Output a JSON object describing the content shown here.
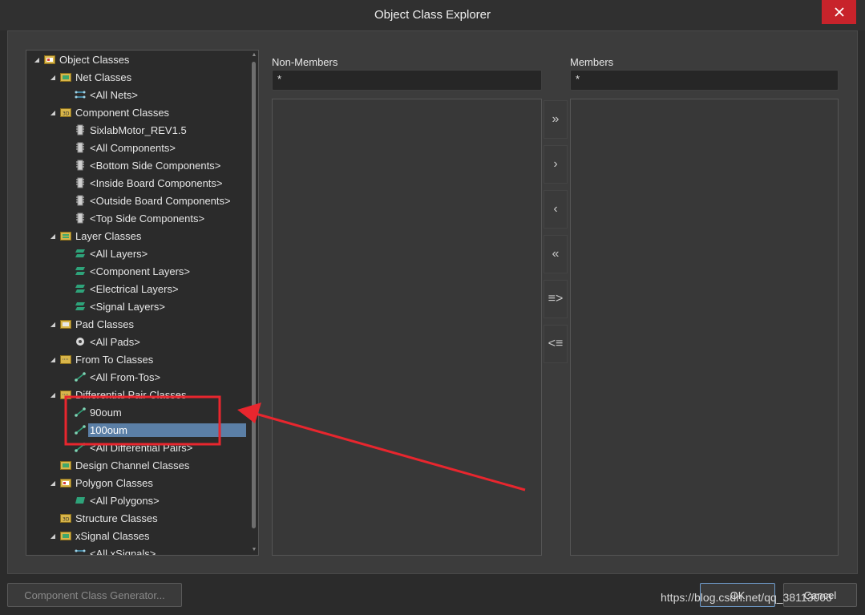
{
  "window": {
    "title": "Object Class Explorer"
  },
  "tree": [
    {
      "label": "Object Classes",
      "level": 0,
      "expanded": true,
      "icon": "object-classes-icon"
    },
    {
      "label": "Net Classes",
      "level": 1,
      "expanded": true,
      "icon": "net-classes-icon"
    },
    {
      "label": "<All Nets>",
      "level": 2,
      "icon": "net-icon"
    },
    {
      "label": "Component Classes",
      "level": 1,
      "expanded": true,
      "icon": "component-classes-icon"
    },
    {
      "label": "SixlabMotor_REV1.5",
      "level": 2,
      "icon": "component-icon"
    },
    {
      "label": "<All Components>",
      "level": 2,
      "icon": "component-icon"
    },
    {
      "label": "<Bottom Side Components>",
      "level": 2,
      "icon": "component-icon"
    },
    {
      "label": "<Inside Board Components>",
      "level": 2,
      "icon": "component-icon"
    },
    {
      "label": "<Outside Board Components>",
      "level": 2,
      "icon": "component-icon"
    },
    {
      "label": "<Top Side Components>",
      "level": 2,
      "icon": "component-icon"
    },
    {
      "label": "Layer Classes",
      "level": 1,
      "expanded": true,
      "icon": "layer-classes-icon"
    },
    {
      "label": "<All Layers>",
      "level": 2,
      "icon": "layer-icon"
    },
    {
      "label": "<Component Layers>",
      "level": 2,
      "icon": "layer-icon"
    },
    {
      "label": "<Electrical Layers>",
      "level": 2,
      "icon": "layer-icon"
    },
    {
      "label": "<Signal Layers>",
      "level": 2,
      "icon": "layer-icon"
    },
    {
      "label": "Pad Classes",
      "level": 1,
      "expanded": true,
      "icon": "pad-classes-icon"
    },
    {
      "label": "<All Pads>",
      "level": 2,
      "icon": "pad-icon"
    },
    {
      "label": "From To Classes",
      "level": 1,
      "expanded": true,
      "icon": "fromto-classes-icon"
    },
    {
      "label": "<All From-Tos>",
      "level": 2,
      "icon": "fromto-icon"
    },
    {
      "label": "Differential Pair Classes",
      "level": 1,
      "expanded": true,
      "icon": "diffpair-classes-icon"
    },
    {
      "label": "90oum",
      "level": 2,
      "icon": "diffpair-icon"
    },
    {
      "label": "100oum",
      "level": 2,
      "icon": "diffpair-icon",
      "selected": true
    },
    {
      "label": "<All Differential Pairs>",
      "level": 2,
      "icon": "diffpair-icon"
    },
    {
      "label": "Design Channel Classes",
      "level": 1,
      "icon": "design-channel-classes-icon"
    },
    {
      "label": "Polygon Classes",
      "level": 1,
      "expanded": true,
      "icon": "polygon-classes-icon"
    },
    {
      "label": "<All Polygons>",
      "level": 2,
      "icon": "polygon-icon"
    },
    {
      "label": "Structure Classes",
      "level": 1,
      "icon": "structure-classes-icon"
    },
    {
      "label": "xSignal Classes",
      "level": 1,
      "expanded": true,
      "icon": "xsignal-classes-icon"
    },
    {
      "label": "<All xSignals>",
      "level": 2,
      "icon": "xsignal-icon"
    }
  ],
  "non_members": {
    "label": "Non-Members",
    "filter": "*"
  },
  "members": {
    "label": "Members",
    "filter": "*"
  },
  "move_buttons": [
    {
      "glyph": "»",
      "name": "move-all-right-button"
    },
    {
      "glyph": "›",
      "name": "move-right-button"
    },
    {
      "glyph": "‹",
      "name": "move-left-button"
    },
    {
      "glyph": "«",
      "name": "move-all-left-button"
    },
    {
      "glyph": "≡>",
      "name": "move-selected-right-button"
    },
    {
      "glyph": "<≡",
      "name": "move-selected-left-button"
    }
  ],
  "footer": {
    "generator_label": "Component Class Generator...",
    "ok_label": "OK",
    "cancel_label": "Cancel"
  },
  "watermark": "https://blog.csdn.net/qq_38113006",
  "colors": {
    "accent": "#5b7fa6",
    "close": "#c8232b",
    "annotation": "#e8262e"
  }
}
